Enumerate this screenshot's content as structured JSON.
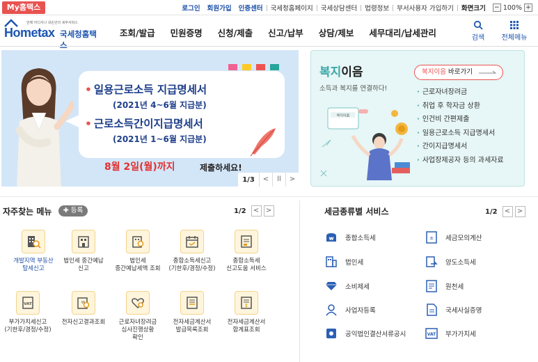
{
  "topbar": {
    "my_tab": "My홈택스",
    "links": [
      "로그인",
      "회원가입",
      "인증센터",
      "국세청홈페이지",
      "국세상담센터",
      "법령정보",
      "부서사용자 가입하기",
      "화면크기"
    ],
    "zoom_minus": "−",
    "zoom_value": "100%",
    "zoom_plus": "+"
  },
  "header": {
    "logo_sub": "언제 어디서나 내손안의 세무서비스",
    "logo_home": "Hometax",
    "logo_kor": "국세청홈택스",
    "nav": [
      "조회/발급",
      "민원증명",
      "신청/제출",
      "신고/납부",
      "상담/제보",
      "세무대리/납세관리"
    ],
    "search_label": "검색",
    "menu_label": "전체메뉴"
  },
  "banner": {
    "line1": "일용근로소득 지급명세서",
    "line2": "(2021년 4~6월 지급분)",
    "line3": "근로소득간이지급명세서",
    "line4": "(2021년 1~6월 지급분)",
    "deadline": "8월 2일(월)까지",
    "deadline_tail": "제출하세요!",
    "page": "1/3",
    "prev": "<",
    "pause": "ll",
    "next": ">",
    "square_colors": [
      "#f06292",
      "#ffca28",
      "#ef5350",
      "#26a69a"
    ]
  },
  "welfare": {
    "title_a": "복지",
    "title_b": "이음",
    "desc": "소득과 복지를 연결하다!",
    "go_a": "복지이음",
    "go_b": " 바로가기",
    "items": [
      "근로자녀장려금",
      "취업 후 학자금 상환",
      "인건비 간편제출",
      "일용근로소득 지급명세서",
      "간이지급명세서",
      "사업장제공자 등의 과세자료"
    ],
    "bubble": "복지이음"
  },
  "favorites": {
    "title": "자주찾는 메뉴",
    "register": "등록",
    "page": "1/2",
    "items": [
      {
        "label": "개발지역 부동산\n탈세신고",
        "icon": "building-search-icon"
      },
      {
        "label": "법인세 중간예납\n신고",
        "icon": "corporate-tax-icon"
      },
      {
        "label": "법인세\n중간예납세액 조회",
        "icon": "corporate-tax-query-icon"
      },
      {
        "label": "종합소득세신고\n(기한후/경정/수정)",
        "icon": "income-tax-calendar-icon"
      },
      {
        "label": "종합소득세\n신고도움 서비스",
        "icon": "income-tax-help-icon"
      },
      {
        "label": "부가가치세신고\n(기한후/경정/수정)",
        "icon": "vat-icon"
      },
      {
        "label": "전자신고결과조회",
        "icon": "e-filing-search-icon"
      },
      {
        "label": "근로자녀장려금\n심사진행상황\n확인",
        "icon": "heart-search-icon"
      },
      {
        "label": "전자세금계산서\n발급목록조회",
        "icon": "e-invoice-list-icon"
      },
      {
        "label": "전자세금계산서\n합계표조회",
        "icon": "e-invoice-total-icon"
      }
    ]
  },
  "tax_services": {
    "title": "세금종류별 서비스",
    "page": "1/2",
    "items": [
      {
        "label": "종합소득세",
        "icon": "income-tax-icon"
      },
      {
        "label": "세금모의계산",
        "icon": "calculator-icon"
      },
      {
        "label": "법인세",
        "icon": "corporation-icon"
      },
      {
        "label": "양도소득세",
        "icon": "transfer-icon"
      },
      {
        "label": "소비제세",
        "icon": "diamond-icon"
      },
      {
        "label": "원천세",
        "icon": "withholding-icon"
      },
      {
        "label": "사업자등록",
        "icon": "person-icon"
      },
      {
        "label": "국세사실증명",
        "icon": "certificate-icon"
      },
      {
        "label": "공익법인결산서류공시",
        "icon": "disclosure-icon"
      },
      {
        "label": "부가가치세",
        "icon": "vat-icon"
      }
    ]
  },
  "colors": {
    "accent_blue": "#1d55b0",
    "accent_red": "#e8524f",
    "teal": "#3ea7a7",
    "banner_bg": "#d3e6f8"
  }
}
